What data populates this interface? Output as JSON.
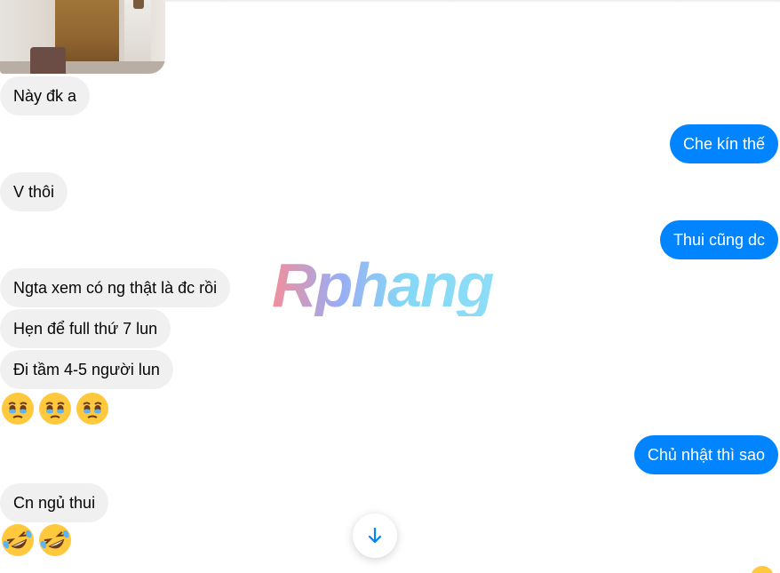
{
  "colors": {
    "incoming_bubble": "#f0f0f0",
    "outgoing_bubble": "#0084ff",
    "emoji_yellow": "#ffc83d",
    "tear_blue": "#5fb3ef"
  },
  "messages": [
    {
      "side": "in",
      "text": "Này đk a"
    },
    {
      "side": "out",
      "text": "Che kín thế"
    },
    {
      "side": "in",
      "text": "V thôi"
    },
    {
      "side": "out",
      "text": "Thui cũng dc"
    },
    {
      "side": "in",
      "text": "Ngta xem có ng thật là đc rồi"
    },
    {
      "side": "in",
      "text": "Hẹn để full thứ 7 lun"
    },
    {
      "side": "in",
      "text": "Đi tầm 4-5 người lun"
    },
    {
      "side": "in",
      "emoji": [
        "holding-back-tears-icon",
        "holding-back-tears-icon",
        "holding-back-tears-icon"
      ]
    },
    {
      "side": "out",
      "text": "Chủ nhật thì sao"
    },
    {
      "side": "in",
      "text": "Cn ngủ thui"
    },
    {
      "side": "in",
      "emoji": [
        "rolling-on-floor-laughing-icon",
        "rolling-on-floor-laughing-icon"
      ]
    }
  ],
  "watermark": "Rphang",
  "scroll_button_icon": "arrow-down-icon"
}
